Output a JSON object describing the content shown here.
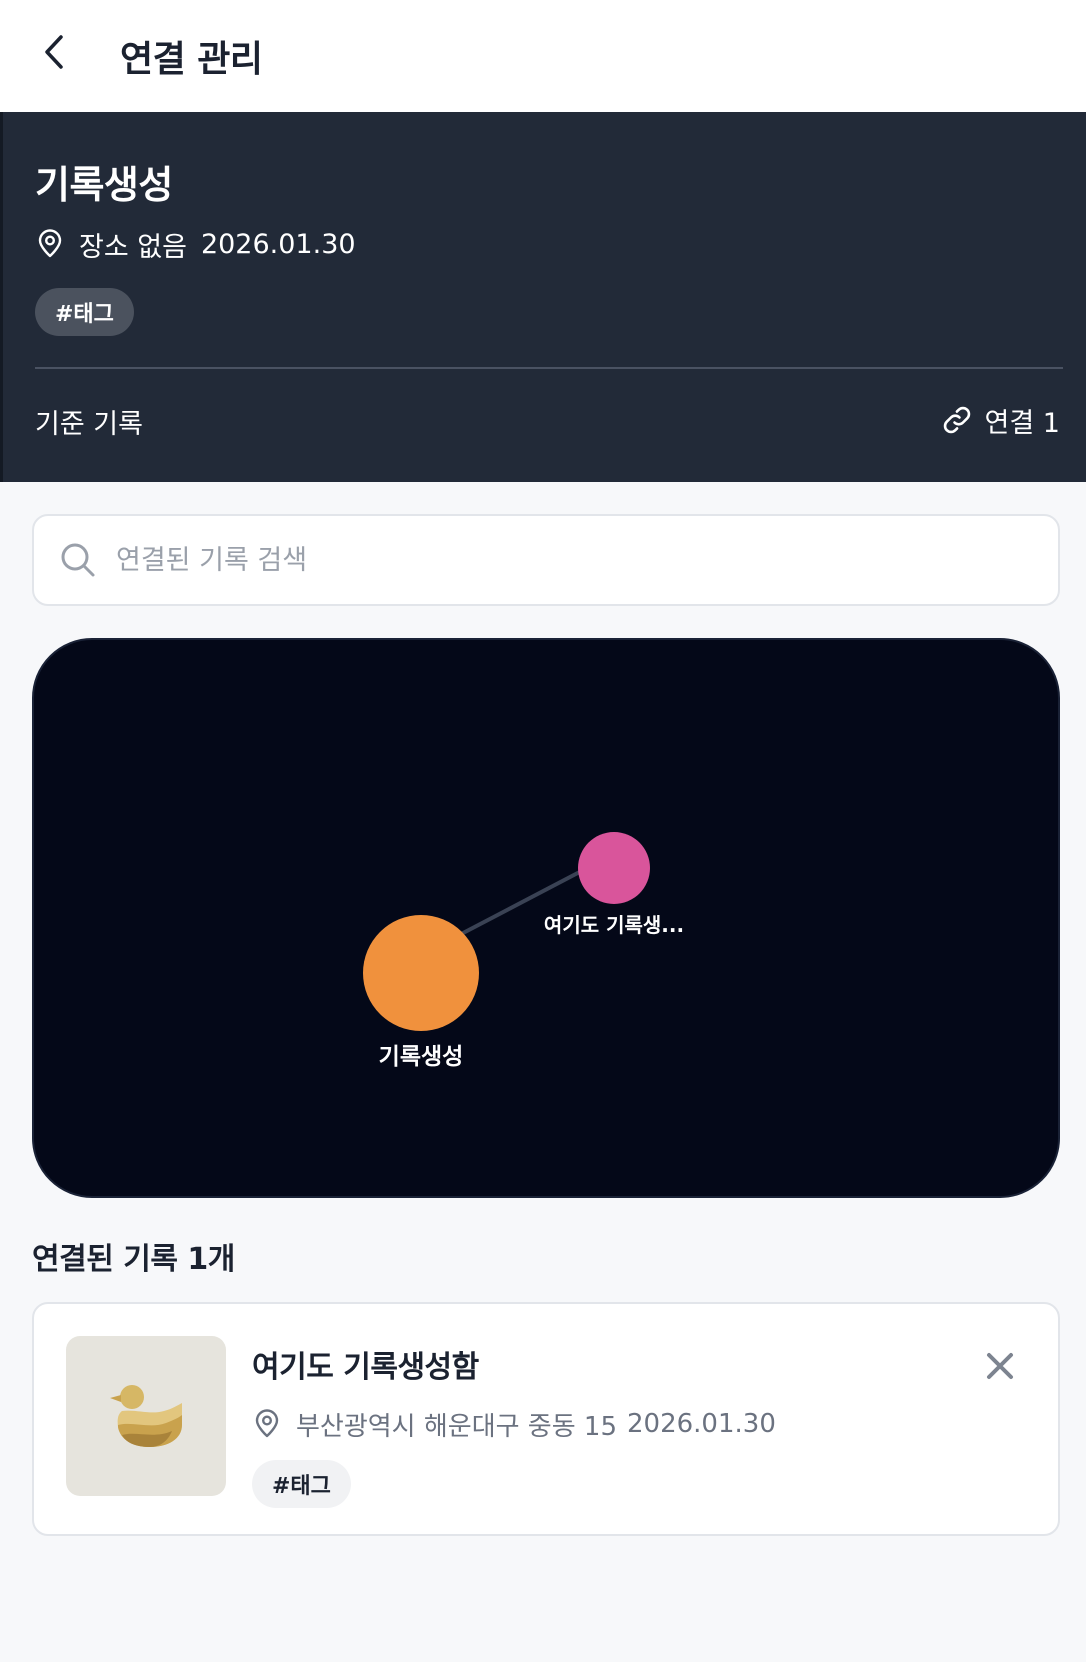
{
  "header": {
    "title": "연결 관리",
    "back_icon": "chevron-left-icon"
  },
  "record": {
    "title": "기록생성",
    "location": "장소 없음",
    "date": "2026.01.30",
    "tag": "#태그",
    "footer_label": "기준 기록",
    "link_label": "연결 1",
    "link_icon": "link-icon",
    "pin_icon": "map-pin-icon"
  },
  "search": {
    "placeholder": "연결된 기록 검색",
    "value": "",
    "icon": "search-icon"
  },
  "graph": {
    "nodes": [
      {
        "label": "기록생성",
        "color": "#f0913d",
        "role": "center"
      },
      {
        "label": "여기도 기록생...",
        "color": "#d9559b",
        "role": "linked"
      }
    ],
    "edge_color": "#3a4254",
    "background": "#040818"
  },
  "linked": {
    "heading": "연결된 기록 1개",
    "items": [
      {
        "title": "여기도 기록생성함",
        "location": "부산광역시 해운대구 중동 15",
        "date": "2026.01.30",
        "tag": "#태그",
        "thumbnail_icon": "duck-icon",
        "remove_icon": "close-icon"
      }
    ]
  },
  "colors": {
    "panel_bg": "#222a38",
    "page_bg": "#f7f8fa",
    "accent_orange": "#f0913d",
    "accent_pink": "#d9559b"
  }
}
